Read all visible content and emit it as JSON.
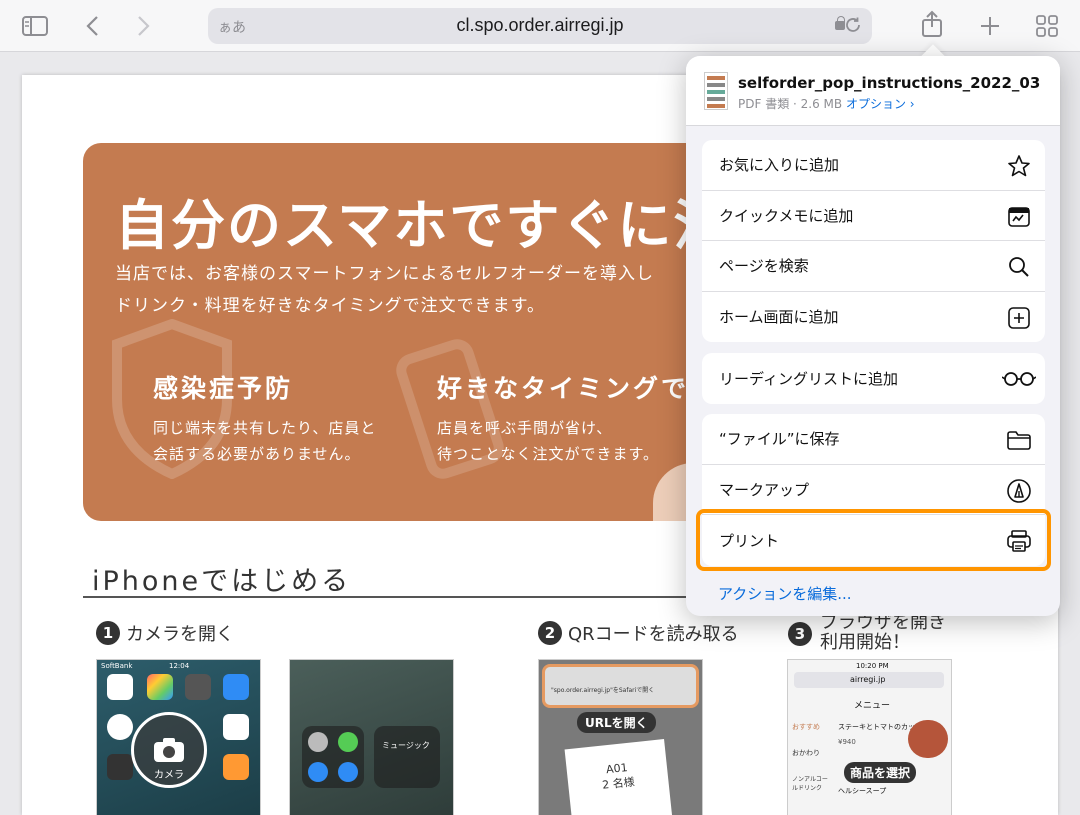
{
  "browser": {
    "address_prefix": "ぁあ",
    "url": "cl.spo.order.airregi.jp"
  },
  "page": {
    "hero": {
      "title": "自分のスマホですぐに注",
      "line1": "当店では、お客様のスマートフォンによるセルフオーダーを導入し",
      "line2": "ドリンク・料理を好きなタイミングで注文できます。",
      "feature1_title": "感染症予防",
      "feature1_line1": "同じ端末を共有したり、店員と",
      "feature1_line2": "会話する必要がありません。",
      "feature2_title": "好きなタイミングで",
      "feature2_line1": "店員を呼ぶ手間が省け、",
      "feature2_line2": "待つことなく注文ができます。"
    },
    "section_title": "iPhoneではじめる",
    "step1": {
      "num": "1",
      "label": "カメラを開く"
    },
    "step2": {
      "num": "2",
      "label": "QRコードを読み取る"
    },
    "step3": {
      "num": "3",
      "line1": "ブラウザを開き",
      "line2": "利用開始！"
    },
    "shot1": {
      "carrier": "SoftBank",
      "time": "12:04",
      "camera_label": "カメラ"
    },
    "shot2": {
      "music": "ミュージック"
    },
    "shot3": {
      "banner": "\"spo.order.airregi.jp\"をSafariで開く",
      "pill": "URLを開く",
      "table": "A01",
      "guests": "2 名様"
    },
    "shot4": {
      "time": "10:20 PM",
      "domain": "airregi.jp",
      "menu": "メニュー",
      "cat1": "おすすめ",
      "cat2": "おかわり",
      "cat3": "ノンアルコールドリンク",
      "item1": "ステーキとトマトのカット",
      "price1": "¥940",
      "item2": "ヘルシースープ",
      "pill": "商品を選択"
    }
  },
  "share_sheet": {
    "doc_title": "selforder_pop_instructions_2022_03",
    "doc_meta": "PDF 書類 · 2.6 MB",
    "doc_options": "オプション ›",
    "group1": [
      {
        "label": "お気に入りに追加",
        "icon": "star-icon"
      },
      {
        "label": "クイックメモに追加",
        "icon": "quick-note-icon"
      },
      {
        "label": "ページを検索",
        "icon": "search-icon"
      },
      {
        "label": "ホーム画面に追加",
        "icon": "plus-square-icon"
      }
    ],
    "group2": [
      {
        "label": "リーディングリストに追加",
        "icon": "glasses-icon"
      }
    ],
    "group3": [
      {
        "label": "“ファイル”に保存",
        "icon": "folder-icon"
      },
      {
        "label": "マークアップ",
        "icon": "markup-icon"
      },
      {
        "label": "プリント",
        "icon": "printer-icon"
      }
    ],
    "edit_actions": "アクションを編集...",
    "highlight_color": "#ff9500"
  }
}
